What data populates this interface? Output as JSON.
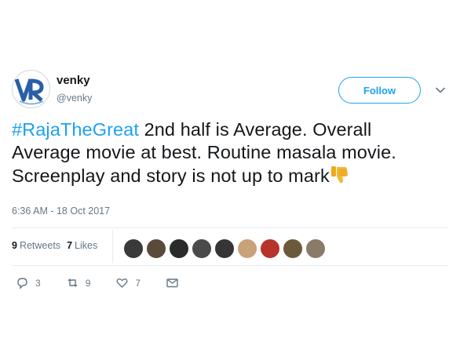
{
  "user": {
    "name": "venky",
    "handle": "@venky",
    "avatar_letters": "VR"
  },
  "follow_button": {
    "label": "Follow"
  },
  "tweet": {
    "hashtag": "#RajaTheGreat",
    "line1_rest": " 2nd half is Average. Overall",
    "line2": "Average movie at best. Routine masala movie.",
    "line3": "Screenplay and story is not up to mark",
    "emoji": "thumbs-down-icon",
    "timestamp": "6:36 AM - 18 Oct 2017"
  },
  "stats": {
    "retweets_count": "9",
    "retweets_label": "Retweets",
    "likes_count": "7",
    "likes_label": "Likes"
  },
  "actions": {
    "reply_count": "3",
    "retweet_count": "9",
    "like_count": "7"
  },
  "colors": {
    "accent": "#1da1f2",
    "muted": "#657786",
    "text": "#14171a",
    "emoji": "#f5b731"
  }
}
